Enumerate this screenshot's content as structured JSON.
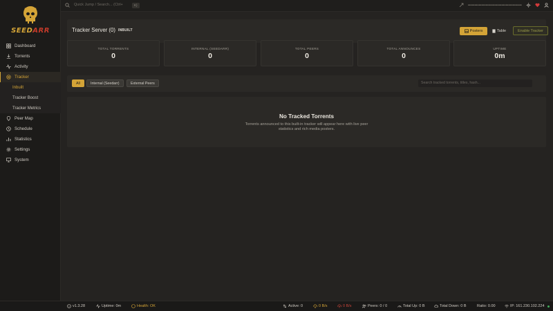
{
  "brand": {
    "word_main": "SEED",
    "word_accent": "ARR"
  },
  "sidebar": {
    "items": [
      {
        "label": "Dashboard",
        "icon": "grid-icon"
      },
      {
        "label": "Torrents",
        "icon": "download-icon"
      },
      {
        "label": "Activity",
        "icon": "pulse-icon"
      },
      {
        "label": "Tracker",
        "icon": "radar-icon"
      },
      {
        "label": "Inbuilt",
        "sub": true
      },
      {
        "label": "Tracker Boost",
        "sub": true
      },
      {
        "label": "Tracker Metrics",
        "sub": true
      },
      {
        "label": "Peer Map",
        "icon": "pin-icon"
      },
      {
        "label": "Schedule",
        "icon": "clock-icon"
      },
      {
        "label": "Statistics",
        "icon": "chart-icon"
      },
      {
        "label": "Settings",
        "icon": "gear-icon"
      },
      {
        "label": "System",
        "icon": "monitor-icon"
      }
    ]
  },
  "topbar": {
    "search_placeholder": "Quick Jump / Search... (Ctrl+",
    "kbd": "K)",
    "masked": "••••••••••••••••••••••••••••••••••••••••"
  },
  "header": {
    "title": "Tracker Server (0)",
    "badge": "INBUILT",
    "posters_label": "Posters",
    "table_label": "Table",
    "enable_label": "Enable Tracker"
  },
  "stats": [
    {
      "label": "TOTAL TORRENTS",
      "value": "0"
    },
    {
      "label": "INTERNAL (SEEDARR)",
      "value": "0"
    },
    {
      "label": "TOTAL PEERS",
      "value": "0"
    },
    {
      "label": "TOTAL ANNOUNCES",
      "value": "0"
    },
    {
      "label": "UPTIME",
      "value": "0m"
    }
  ],
  "filters": {
    "chips": [
      "All",
      "Internal (Seedarr)",
      "External Peers"
    ],
    "search_placeholder": "Search tracked torrents, titles, hash..."
  },
  "empty": {
    "title": "No Tracked Torrents",
    "description": "Torrents announced to this built-in tracker will appear here with live peer statistics and rich media posters."
  },
  "status": {
    "version": "v1.3.28",
    "uptime": "Uptime: 0m",
    "health": "Health: OK",
    "active": "Active: 0",
    "down_speed": "0 B/s",
    "up_speed": "0 B/s",
    "peers": "Peers: 0 / 0",
    "total_up": "Total Up: 0 B",
    "total_down": "Total Down: 0 B",
    "ratio": "Ratio: 0.00",
    "ip": "IP: 161.230.102.224"
  },
  "colors": {
    "accent": "#d4a437",
    "danger": "#c43a2a",
    "ok": "#3fae5a"
  }
}
